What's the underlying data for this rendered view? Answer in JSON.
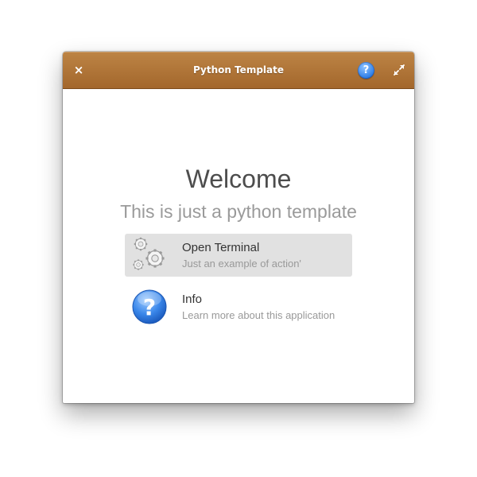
{
  "window": {
    "title": "Python Template",
    "titlebar_color": "#b07335",
    "close_label": "×",
    "help_label": "?"
  },
  "main": {
    "heading": "Welcome",
    "subtitle": "This is just a python template"
  },
  "actions": [
    {
      "title": "Open Terminal",
      "description": "Just an example of action'",
      "icon": "gears-icon",
      "selected": true
    },
    {
      "title": "Info",
      "description": "Learn more about this application",
      "icon": "help-icon",
      "selected": false
    }
  ]
}
